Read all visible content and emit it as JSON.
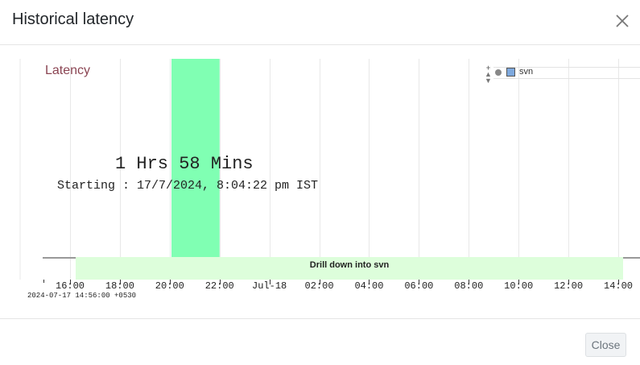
{
  "dialog": {
    "title": "Historical latency",
    "close_label": "Close"
  },
  "chart": {
    "label": "Latency",
    "highlight": {
      "duration": "1 Hrs 58 Mins",
      "starting": "Starting : 17/7/2024, 8:04:22 pm IST"
    },
    "drill_down_label": "Drill down into svn",
    "timestamp": "2024-07-17 14:56:00 +0530",
    "legend": {
      "series_name": "svn",
      "controls_icon": "up-down-arrows-icon"
    }
  },
  "chart_data": {
    "type": "bar",
    "x_tick_labels": [
      "16:00",
      "18:00",
      "20:00",
      "22:00",
      "Jul-18",
      "02:00",
      "04:00",
      "06:00",
      "08:00",
      "10:00",
      "12:00",
      "14:00"
    ],
    "x_tick_hours": [
      16,
      18,
      20,
      22,
      24,
      26,
      28,
      30,
      32,
      34,
      36,
      38
    ],
    "xlim_hours": [
      14.93,
      38.0
    ],
    "series": [
      {
        "name": "svn",
        "values": [
          {
            "start_hour": 20.07,
            "end_hour": 22.0,
            "duration": "1 Hrs 58 Mins"
          }
        ]
      }
    ],
    "grid": true,
    "legend_position": "top-right"
  },
  "colors": {
    "highlight": "#80ffb3",
    "drill_bar": "#ddfedb",
    "label": "#8b4553",
    "legend_swatch": "#7ea9de"
  }
}
